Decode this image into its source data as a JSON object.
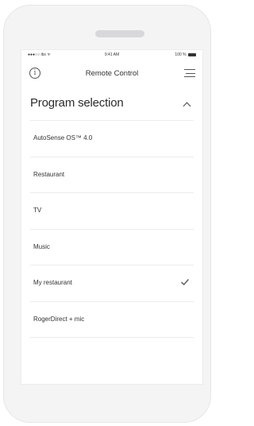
{
  "status_bar": {
    "carrier": "●●●○○ ibs ᯤ",
    "time": "9:41 AM",
    "battery": "100 %"
  },
  "nav": {
    "title": "Remote Control",
    "info_icon": "info-icon",
    "menu_icon": "menu-icon"
  },
  "section": {
    "title": "Program selection",
    "collapse_icon": "chevron-up-icon"
  },
  "programs": [
    {
      "label": "AutoSense OS™ 4.0",
      "selected": false
    },
    {
      "label": "Restaurant",
      "selected": false
    },
    {
      "label": "TV",
      "selected": false
    },
    {
      "label": "Music",
      "selected": false
    },
    {
      "label": "My restaurant",
      "selected": true
    },
    {
      "label": "RogerDirect + mic",
      "selected": false
    }
  ],
  "colors": {
    "text": "#333333",
    "divider": "#ececee",
    "frame": "#f4f4f5"
  }
}
